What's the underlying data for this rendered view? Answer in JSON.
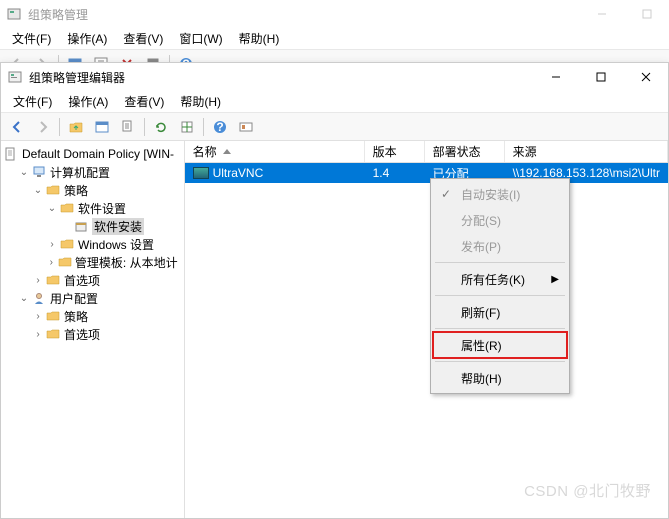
{
  "win1": {
    "title": "组策略管理",
    "menu": [
      "文件(F)",
      "操作(A)",
      "查看(V)",
      "窗口(W)",
      "帮助(H)"
    ]
  },
  "win2": {
    "title": "组策略管理编辑器",
    "menu": [
      "文件(F)",
      "操作(A)",
      "查看(V)",
      "帮助(H)"
    ]
  },
  "tree": {
    "root": "Default Domain Policy [WIN-",
    "n_comp": "计算机配置",
    "n_pol": "策略",
    "n_sw": "软件设置",
    "n_swinst": "软件安装",
    "n_winset": "Windows 设置",
    "n_admtpl": "管理模板: 从本地计",
    "n_pref1": "首选项",
    "n_user": "用户配置",
    "n_pol2": "策略",
    "n_pref2": "首选项"
  },
  "list": {
    "h0": "名称",
    "h1": "版本",
    "h2": "部署状态",
    "h3": "来源",
    "row": {
      "name": "UltraVNC",
      "ver": "1.4",
      "state": "已分配",
      "src": "\\\\192.168.153.128\\msi2\\Ultr"
    }
  },
  "ctx": {
    "auto": "自动安装(I)",
    "assign": "分配(S)",
    "publish": "发布(P)",
    "alltasks": "所有任务(K)",
    "refresh": "刷新(F)",
    "props": "属性(R)",
    "help": "帮助(H)"
  },
  "watermark": "CSDN @北门牧野"
}
